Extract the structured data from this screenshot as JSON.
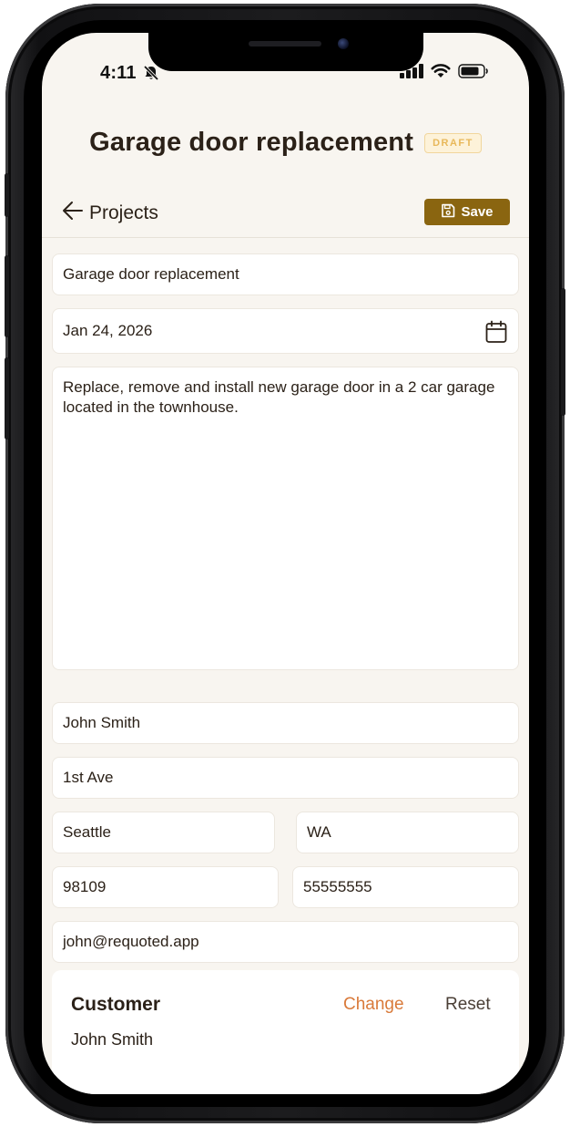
{
  "status_bar": {
    "time": "4:11"
  },
  "header": {
    "title": "Garage door replacement",
    "badge": "DRAFT"
  },
  "nav": {
    "back_label": "Projects",
    "save_label": "Save"
  },
  "form": {
    "project_name": "Garage door replacement",
    "date": "Jan 24, 2026",
    "description": "Replace, remove and install new garage door in a 2 car garage located in the townhouse.",
    "customer_name": "John Smith",
    "street": "1st Ave",
    "city": "Seattle",
    "state": "WA",
    "zip": "98109",
    "phone": "55555555",
    "email": "john@requoted.app"
  },
  "customer_card": {
    "label": "Customer",
    "change_label": "Change",
    "reset_label": "Reset",
    "name": "John Smith"
  },
  "colors": {
    "background": "#f8f5f0",
    "save_button": "#8a6510",
    "change_link": "#d97a3a",
    "badge_text": "#e8b85a"
  },
  "icons": [
    "bell-slash-icon",
    "signal-icon",
    "wifi-icon",
    "battery-icon",
    "arrow-left-icon",
    "floppy-disk-icon",
    "calendar-icon"
  ]
}
